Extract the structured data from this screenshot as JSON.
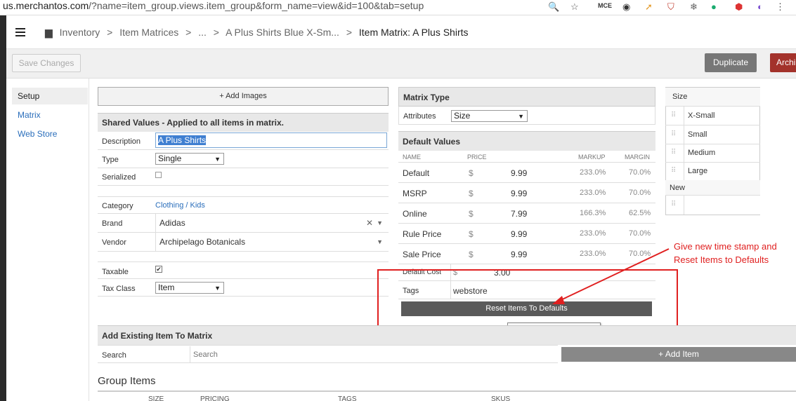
{
  "browser": {
    "url_host": "us.merchantos.com",
    "url_path": "/?name=item_group.views.item_group&form_name=view&id=100&tab=setup"
  },
  "breadcrumb": {
    "items": [
      "Inventory",
      ">",
      "Item Matrices",
      ">",
      "...",
      ">",
      "A Plus Shirts Blue X-Sm...",
      ">"
    ],
    "current": "Item Matrix:  A Plus Shirts"
  },
  "toolbar": {
    "save_label": "Save Changes",
    "duplicate_label": "Duplicate",
    "archive_label": "Archi"
  },
  "nav": {
    "items": [
      "Setup",
      "Matrix",
      "Web Store"
    ]
  },
  "add_images_label": "+ Add Images",
  "shared": {
    "title": "Shared Values - Applied to all items in matrix.",
    "description_label": "Description",
    "description_value": "A Plus Shirts",
    "type_label": "Type",
    "type_value": "Single",
    "serialized_label": "Serialized",
    "category_label": "Category",
    "category_value": "Clothing / Kids",
    "brand_label": "Brand",
    "brand_value": "Adidas",
    "vendor_label": "Vendor",
    "vendor_value": "Archipelago Botanicals",
    "taxable_label": "Taxable",
    "taxclass_label": "Tax Class",
    "taxclass_value": "Item"
  },
  "matrix_type": {
    "title": "Matrix Type",
    "attributes_label": "Attributes",
    "attributes_value": "Size"
  },
  "default_values": {
    "title": "Default Values",
    "headers": {
      "name": "NAME",
      "price": "PRICE",
      "markup": "MARKUP",
      "margin": "MARGIN"
    },
    "rows": [
      {
        "name": "Default",
        "currency": "$",
        "price": "9.99",
        "markup": "233.0%",
        "margin": "70.0%"
      },
      {
        "name": "MSRP",
        "currency": "$",
        "price": "9.99",
        "markup": "233.0%",
        "margin": "70.0%"
      },
      {
        "name": "Online",
        "currency": "$",
        "price": "7.99",
        "markup": "166.3%",
        "margin": "62.5%"
      },
      {
        "name": "Rule Price",
        "currency": "$",
        "price": "9.99",
        "markup": "233.0%",
        "margin": "70.0%"
      },
      {
        "name": "Sale Price",
        "currency": "$",
        "price": "9.99",
        "markup": "233.0%",
        "margin": "70.0%"
      }
    ],
    "cost_label": "Default Cost",
    "cost_currency": "$",
    "cost_value": "3.00",
    "tags_label": "Tags",
    "tags_value": "webstore",
    "reset_label": "Reset Items To Defaults",
    "tooltip": "Reset Items To Defaults"
  },
  "sizes": {
    "title": "Size",
    "items": [
      "X-Small",
      "Small",
      "Medium",
      "Large"
    ],
    "new_label": "New"
  },
  "annotation": {
    "line1": "Give new time stamp and",
    "line2": "Reset Items to Defaults",
    "color": "#e02020"
  },
  "add_existing": {
    "title": "Add Existing Item To Matrix",
    "search_label": "Search",
    "search_placeholder": "Search",
    "add_item_label": "+ Add Item"
  },
  "group_items": {
    "title": "Group Items",
    "headers": [
      "SIZE",
      "PRICING",
      "TAGS",
      "SKUS"
    ]
  }
}
